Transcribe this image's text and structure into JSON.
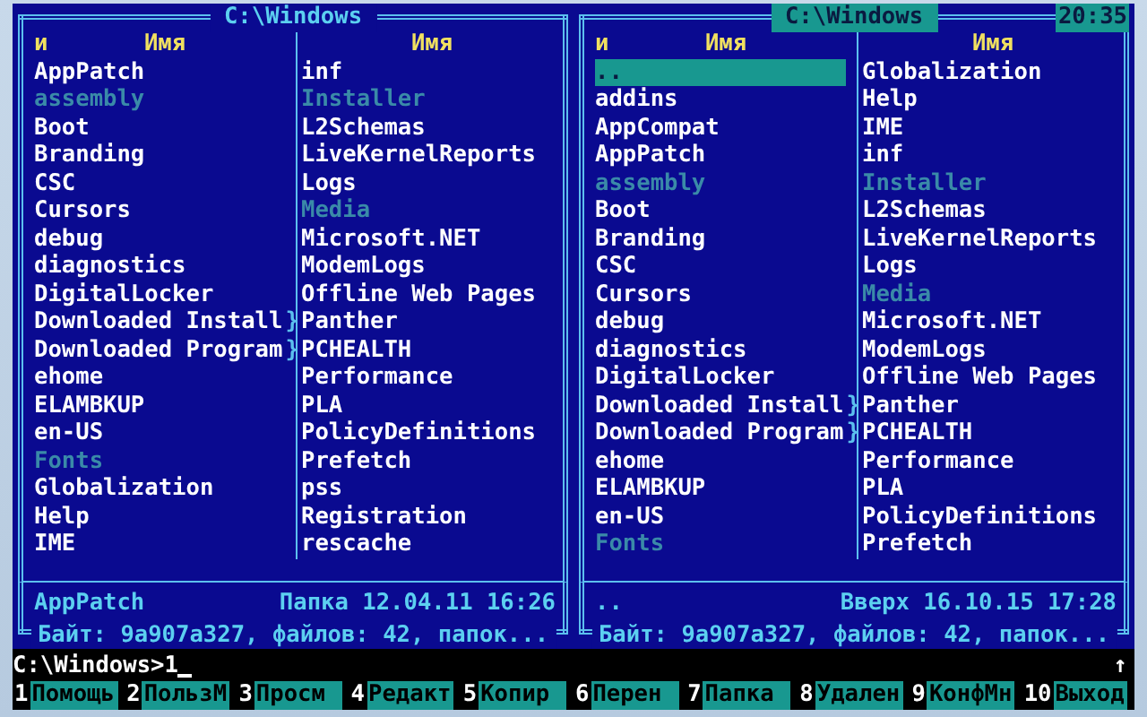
{
  "left_panel": {
    "title": "C:\\Windows",
    "active": false,
    "columns": [
      {
        "header_prefix": "и",
        "header": "Имя",
        "items": [
          {
            "name": "AppPatch",
            "hidden": false,
            "selected": false
          },
          {
            "name": "assembly",
            "hidden": true,
            "selected": false
          },
          {
            "name": "Boot",
            "hidden": false,
            "selected": false
          },
          {
            "name": "Branding",
            "hidden": false,
            "selected": false
          },
          {
            "name": "CSC",
            "hidden": false,
            "selected": false
          },
          {
            "name": "Cursors",
            "hidden": false,
            "selected": false
          },
          {
            "name": "debug",
            "hidden": false,
            "selected": false
          },
          {
            "name": "diagnostics",
            "hidden": false,
            "selected": false
          },
          {
            "name": "DigitalLocker",
            "hidden": false,
            "selected": false
          },
          {
            "name": "Downloaded Install",
            "overflow": "}",
            "hidden": false,
            "selected": false
          },
          {
            "name": "Downloaded Program",
            "overflow": "}",
            "hidden": false,
            "selected": false
          },
          {
            "name": "ehome",
            "hidden": false,
            "selected": false
          },
          {
            "name": "ELAMBKUP",
            "hidden": false,
            "selected": false
          },
          {
            "name": "en-US",
            "hidden": false,
            "selected": false
          },
          {
            "name": "Fonts",
            "hidden": true,
            "selected": false
          },
          {
            "name": "Globalization",
            "hidden": false,
            "selected": false
          },
          {
            "name": "Help",
            "hidden": false,
            "selected": false
          },
          {
            "name": "IME",
            "hidden": false,
            "selected": false
          }
        ]
      },
      {
        "header": "Имя",
        "items": [
          {
            "name": "inf",
            "hidden": false,
            "selected": false
          },
          {
            "name": "Installer",
            "hidden": true,
            "selected": false
          },
          {
            "name": "L2Schemas",
            "hidden": false,
            "selected": false
          },
          {
            "name": "LiveKernelReports",
            "hidden": false,
            "selected": false
          },
          {
            "name": "Logs",
            "hidden": false,
            "selected": false
          },
          {
            "name": "Media",
            "hidden": true,
            "selected": false
          },
          {
            "name": "Microsoft.NET",
            "hidden": false,
            "selected": false
          },
          {
            "name": "ModemLogs",
            "hidden": false,
            "selected": false
          },
          {
            "name": "Offline Web Pages",
            "hidden": false,
            "selected": false
          },
          {
            "name": "Panther",
            "hidden": false,
            "selected": false
          },
          {
            "name": "PCHEALTH",
            "hidden": false,
            "selected": false
          },
          {
            "name": "Performance",
            "hidden": false,
            "selected": false
          },
          {
            "name": "PLA",
            "hidden": false,
            "selected": false
          },
          {
            "name": "PolicyDefinitions",
            "hidden": false,
            "selected": false
          },
          {
            "name": "Prefetch",
            "hidden": false,
            "selected": false
          },
          {
            "name": "pss",
            "hidden": false,
            "selected": false
          },
          {
            "name": "Registration",
            "hidden": false,
            "selected": false
          },
          {
            "name": "rescache",
            "hidden": false,
            "selected": false
          }
        ]
      }
    ],
    "info": {
      "name": "AppPatch",
      "details": "Папка 12.04.11 16:26"
    },
    "summary": "Байт: 9a907a327, файлов: 42, папок..."
  },
  "right_panel": {
    "title": "C:\\Windows",
    "active": true,
    "clock": "20:35",
    "columns": [
      {
        "header_prefix": "и",
        "header": "Имя",
        "items": [
          {
            "name": "..",
            "hidden": false,
            "selected": true
          },
          {
            "name": "addins",
            "hidden": false,
            "selected": false
          },
          {
            "name": "AppCompat",
            "hidden": false,
            "selected": false
          },
          {
            "name": "AppPatch",
            "hidden": false,
            "selected": false
          },
          {
            "name": "assembly",
            "hidden": true,
            "selected": false
          },
          {
            "name": "Boot",
            "hidden": false,
            "selected": false
          },
          {
            "name": "Branding",
            "hidden": false,
            "selected": false
          },
          {
            "name": "CSC",
            "hidden": false,
            "selected": false
          },
          {
            "name": "Cursors",
            "hidden": false,
            "selected": false
          },
          {
            "name": "debug",
            "hidden": false,
            "selected": false
          },
          {
            "name": "diagnostics",
            "hidden": false,
            "selected": false
          },
          {
            "name": "DigitalLocker",
            "hidden": false,
            "selected": false
          },
          {
            "name": "Downloaded Install",
            "overflow": "}",
            "hidden": false,
            "selected": false
          },
          {
            "name": "Downloaded Program",
            "overflow": "}",
            "hidden": false,
            "selected": false
          },
          {
            "name": "ehome",
            "hidden": false,
            "selected": false
          },
          {
            "name": "ELAMBKUP",
            "hidden": false,
            "selected": false
          },
          {
            "name": "en-US",
            "hidden": false,
            "selected": false
          },
          {
            "name": "Fonts",
            "hidden": true,
            "selected": false
          }
        ]
      },
      {
        "header": "Имя",
        "items": [
          {
            "name": "Globalization",
            "hidden": false,
            "selected": false
          },
          {
            "name": "Help",
            "hidden": false,
            "selected": false
          },
          {
            "name": "IME",
            "hidden": false,
            "selected": false
          },
          {
            "name": "inf",
            "hidden": false,
            "selected": false
          },
          {
            "name": "Installer",
            "hidden": true,
            "selected": false
          },
          {
            "name": "L2Schemas",
            "hidden": false,
            "selected": false
          },
          {
            "name": "LiveKernelReports",
            "hidden": false,
            "selected": false
          },
          {
            "name": "Logs",
            "hidden": false,
            "selected": false
          },
          {
            "name": "Media",
            "hidden": true,
            "selected": false
          },
          {
            "name": "Microsoft.NET",
            "hidden": false,
            "selected": false
          },
          {
            "name": "ModemLogs",
            "hidden": false,
            "selected": false
          },
          {
            "name": "Offline Web Pages",
            "hidden": false,
            "selected": false
          },
          {
            "name": "Panther",
            "hidden": false,
            "selected": false
          },
          {
            "name": "PCHEALTH",
            "hidden": false,
            "selected": false
          },
          {
            "name": "Performance",
            "hidden": false,
            "selected": false
          },
          {
            "name": "PLA",
            "hidden": false,
            "selected": false
          },
          {
            "name": "PolicyDefinitions",
            "hidden": false,
            "selected": false
          },
          {
            "name": "Prefetch",
            "hidden": false,
            "selected": false
          }
        ]
      }
    ],
    "info": {
      "name": "..",
      "details": "Вверх 16.10.15 17:28"
    },
    "summary": "Байт: 9a907a327, файлов: 42, папок..."
  },
  "command_line": {
    "value": "C:\\Windows>1"
  },
  "scroll_indicator": "↑",
  "keybar": [
    {
      "number": "1",
      "label": "Помощь"
    },
    {
      "number": "2",
      "label": "ПользМ"
    },
    {
      "number": "3",
      "label": "Просм"
    },
    {
      "number": "4",
      "label": "Редакт"
    },
    {
      "number": "5",
      "label": "Копир"
    },
    {
      "number": "6",
      "label": "Перен"
    },
    {
      "number": "7",
      "label": "Папка"
    },
    {
      "number": "8",
      "label": "Удален"
    },
    {
      "number": "9",
      "label": "КонфМн"
    },
    {
      "number": "10",
      "label": "Выход"
    }
  ]
}
